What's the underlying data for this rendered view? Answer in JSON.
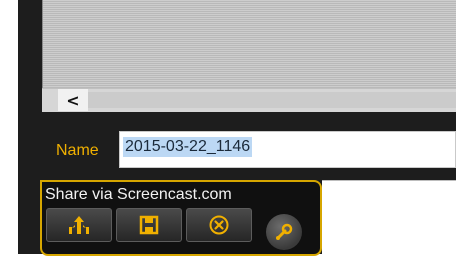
{
  "capture": {
    "name_label": "Name",
    "name_value": "2015-03-22_1146",
    "scroll_left_glyph": "<"
  },
  "share": {
    "label": "Share via Screencast.com"
  },
  "toolbar": {
    "buttons": [
      {
        "icon": "upload-share-icon"
      },
      {
        "icon": "save-disk-icon"
      },
      {
        "icon": "cancel-circle-x-icon"
      },
      {
        "icon": "wrench-settings-icon"
      }
    ]
  },
  "colors": {
    "accent_gold": "#f0b000",
    "panel_dark": "#1d1d1d",
    "selection": "#bcd8f4"
  }
}
